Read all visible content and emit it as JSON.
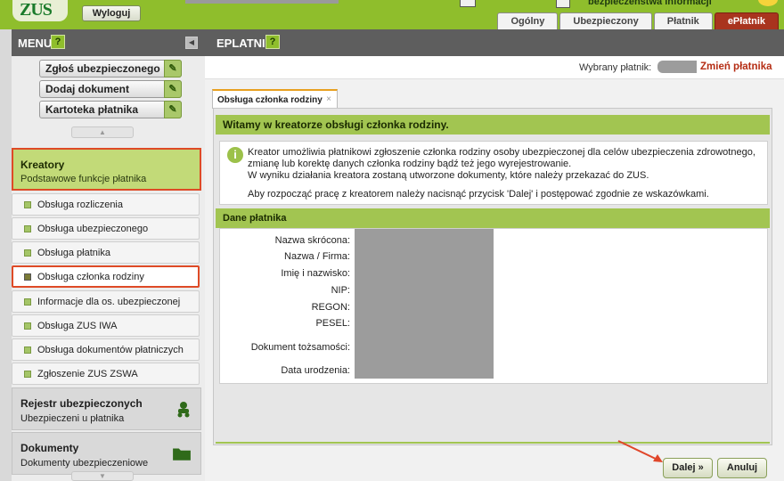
{
  "header": {
    "logo_text": "ZUS",
    "logout_label": "Wyloguj",
    "info_text": "bezpieczeństwa informacji",
    "tabs": [
      {
        "label": "Ogólny"
      },
      {
        "label": "Ubezpieczony"
      },
      {
        "label": "Płatnik"
      },
      {
        "label": "ePłatnik"
      }
    ],
    "active_tab": "ePłatnik"
  },
  "sidebar": {
    "title": "MENU",
    "help": "?",
    "quick_actions": [
      {
        "label": "Zgłoś ubezpieczonego"
      },
      {
        "label": "Dodaj dokument"
      },
      {
        "label": "Kartoteka płatnika"
      }
    ],
    "active_section": {
      "title": "Kreatory",
      "subtitle": "Podstawowe funkcje płatnika"
    },
    "items": [
      {
        "label": "Obsługa rozliczenia"
      },
      {
        "label": "Obsługa ubezpieczonego"
      },
      {
        "label": "Obsługa płatnika"
      },
      {
        "label": "Obsługa członka rodziny"
      },
      {
        "label": "Informacje dla os. ubezpieczonej"
      },
      {
        "label": "Obsługa ZUS IWA"
      },
      {
        "label": "Obsługa dokumentów płatniczych"
      },
      {
        "label": "Zgłoszenie ZUS ZSWA"
      }
    ],
    "selected_item": "Obsługa członka rodziny",
    "sections": [
      {
        "title": "Rejestr ubezpieczonych",
        "subtitle": "Ubezpieczeni u płatnika"
      },
      {
        "title": "Dokumenty",
        "subtitle": "Dokumenty ubezpieczeniowe"
      }
    ]
  },
  "main": {
    "title": "EPLATNIK",
    "help": "?",
    "payer_label": "Wybrany płatnik:",
    "change_payer_link": "Zmień płatnika",
    "tab_label": "Obsługa członka rodziny",
    "tab_close": "×",
    "wizard_title": "Witamy w kreatorze obsługi członka rodziny.",
    "info_lines": [
      "Kreator umożliwia płatnikowi zgłoszenie członka rodziny osoby ubezpieczonej dla celów ubezpieczenia zdrowotnego,",
      "zmianę lub korektę danych członka rodziny bądź też jego wyrejestrowanie.",
      "W wyniku działania kreatora zostaną utworzone dokumenty, które należy przekazać do ZUS.",
      "Aby rozpocząć pracę z kreatorem należy nacisnąć przycisk 'Dalej' i postępować zgodnie ze wskazówkami."
    ],
    "payer_data_title": "Dane płatnika",
    "fields": [
      {
        "label": "Nazwa skrócona:"
      },
      {
        "label": "Nazwa / Firma:"
      },
      {
        "label": "Imię i nazwisko:"
      },
      {
        "label": "NIP:"
      },
      {
        "label": "REGON:"
      },
      {
        "label": "PESEL:"
      },
      {
        "label": "Dokument tożsamości:"
      },
      {
        "label": "Data urodzenia:"
      }
    ],
    "next_label": "Dalej »",
    "cancel_label": "Anuluj"
  },
  "colors": {
    "accent_green": "#a2c551",
    "brand_red": "#a9341e",
    "highlight_orange": "#de4a26"
  }
}
